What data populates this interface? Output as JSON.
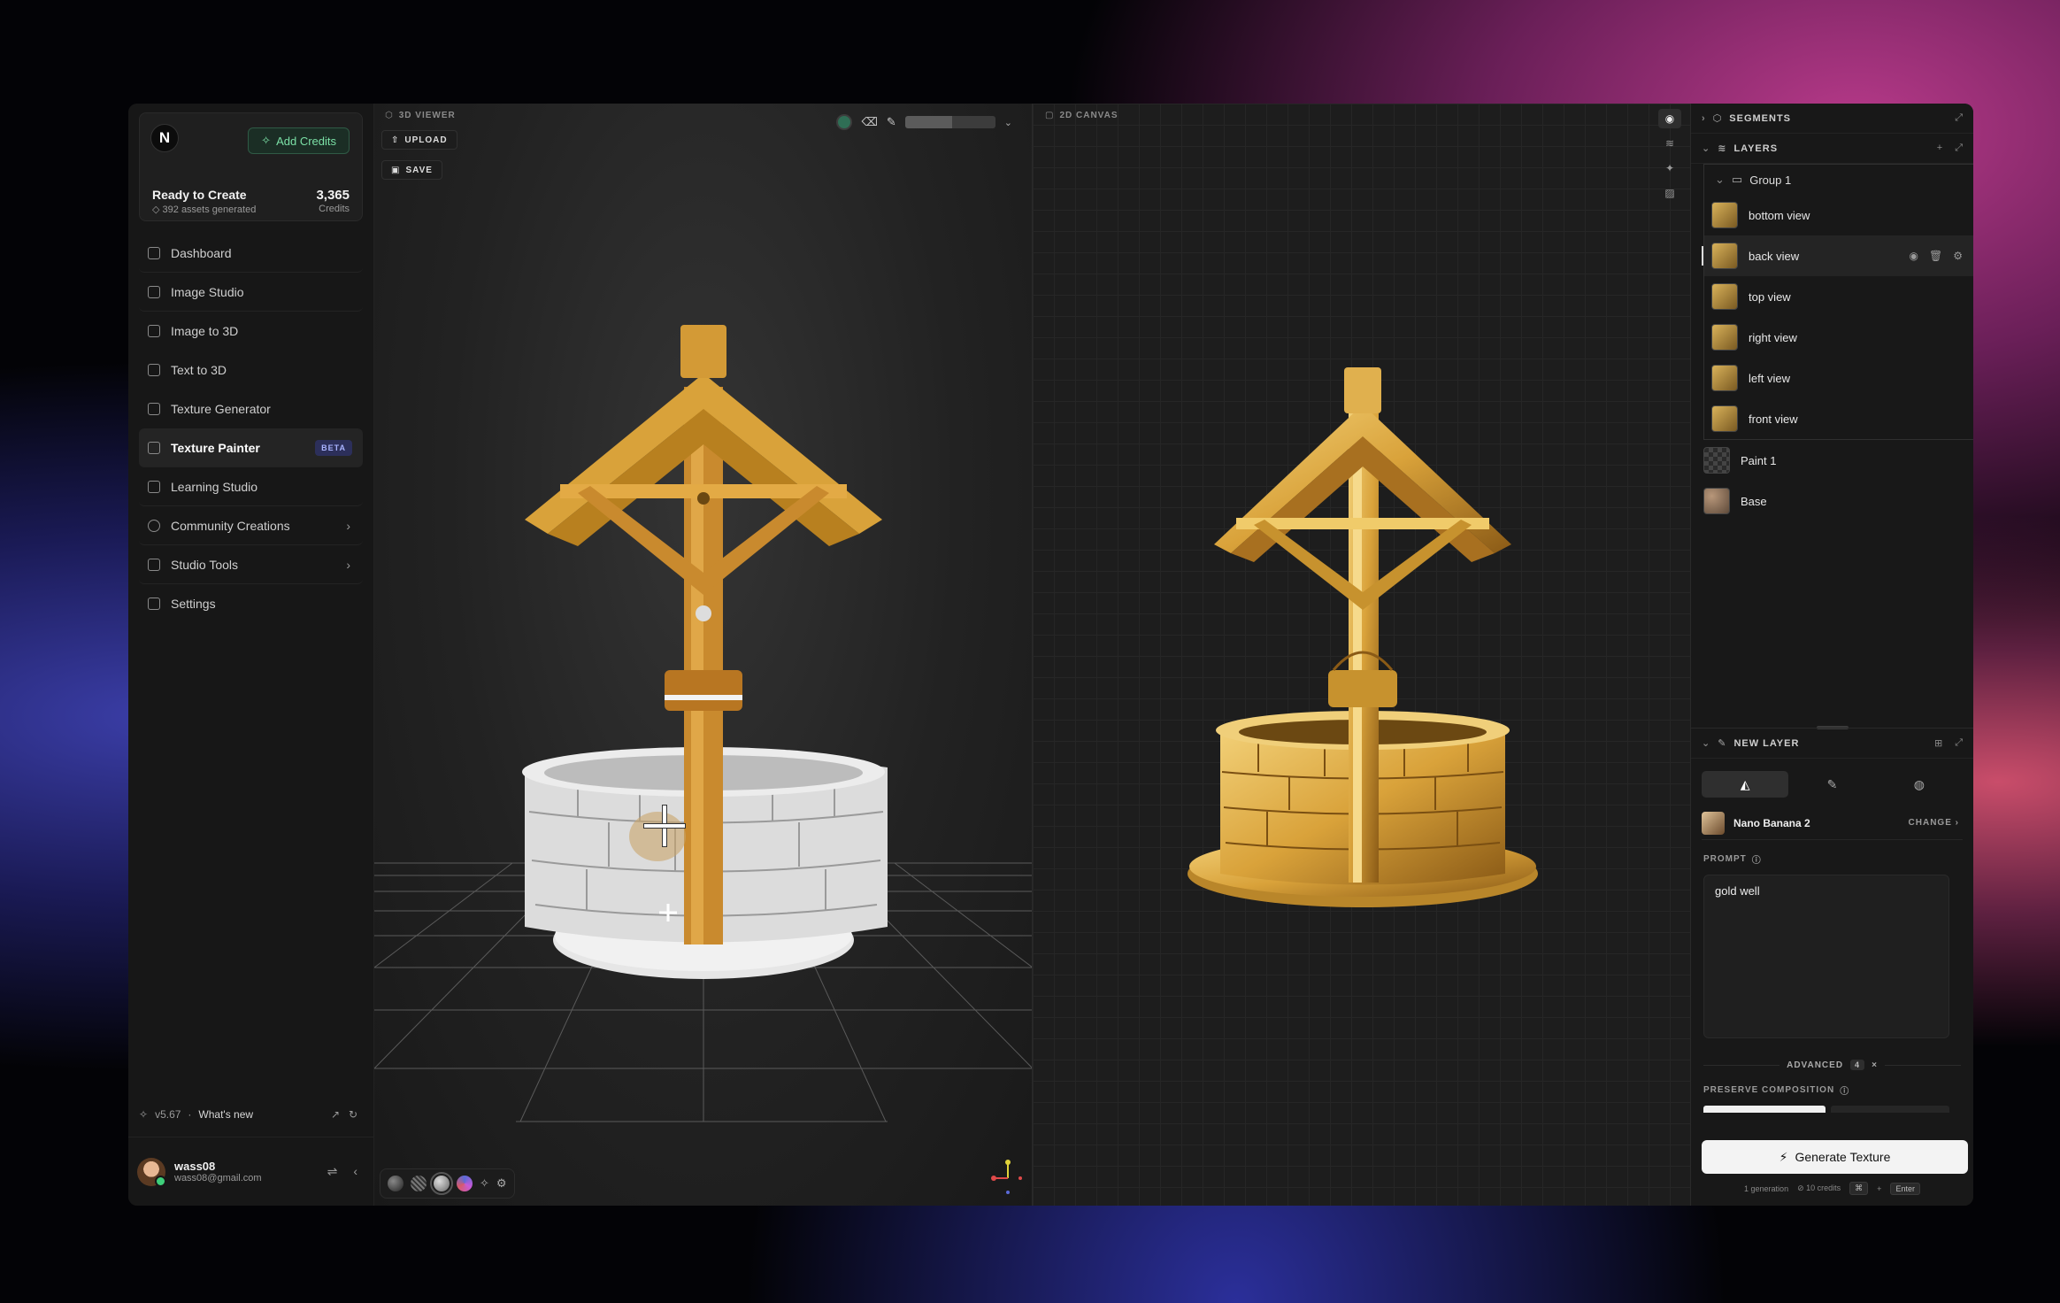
{
  "account": {
    "logo": "N",
    "add_credits": "Add Credits",
    "status": "Ready to Create",
    "assets": "392 assets generated",
    "credits_value": "3,365",
    "credits_label": "Credits"
  },
  "nav": [
    {
      "label": "Dashboard",
      "icon": "home-icon"
    },
    {
      "label": "Image Studio",
      "icon": "image-studio-icon"
    },
    {
      "label": "Image to 3D",
      "icon": "image-to-3d-icon"
    },
    {
      "label": "Text to 3D",
      "icon": "text-to-3d-icon"
    },
    {
      "label": "Texture Generator",
      "icon": "texture-generator-icon"
    },
    {
      "label": "Texture Painter",
      "icon": "brush-icon",
      "badge": "BETA",
      "active": true
    },
    {
      "label": "Learning Studio",
      "icon": "graduation-cap-icon"
    },
    {
      "label": "Community Creations",
      "icon": "globe-icon"
    },
    {
      "label": "Studio Tools",
      "icon": "tools-icon"
    },
    {
      "label": "Settings",
      "icon": "settings-icon"
    }
  ],
  "footer": {
    "version": "v5.67",
    "separator": "·",
    "whats_new": "What's new",
    "username": "wass08",
    "email": "wass08@gmail.com"
  },
  "viewer3d": {
    "label": "3D VIEWER",
    "upload": "UPLOAD",
    "save": "SAVE"
  },
  "canvas2d": {
    "label": "2D CANVAS"
  },
  "panel": {
    "segments": "SEGMENTS",
    "layers": "LAYERS",
    "group": "Group 1",
    "group_layers": [
      "bottom view",
      "back view",
      "top view",
      "right view",
      "left view",
      "front view"
    ],
    "selected_layer": "back view",
    "paint_layer": "Paint 1",
    "base_layer": "Base"
  },
  "new_layer": {
    "title": "NEW LAYER",
    "model": "Nano Banana 2",
    "change": "CHANGE",
    "prompt_label": "PROMPT",
    "prompt_value": "gold well",
    "advanced": "ADVANCED",
    "advanced_count": "4",
    "preserve": "PRESERVE COMPOSITION",
    "generate": "Generate Texture",
    "meta_generation": "1 generation",
    "meta_credits": "10 credits",
    "kbd_mod": "⌘",
    "kbd_enter": "Enter"
  },
  "colors": {
    "accent_green": "#7be0a6",
    "gold": "#d9a23a",
    "beta_bg": "#2c2f5a"
  }
}
